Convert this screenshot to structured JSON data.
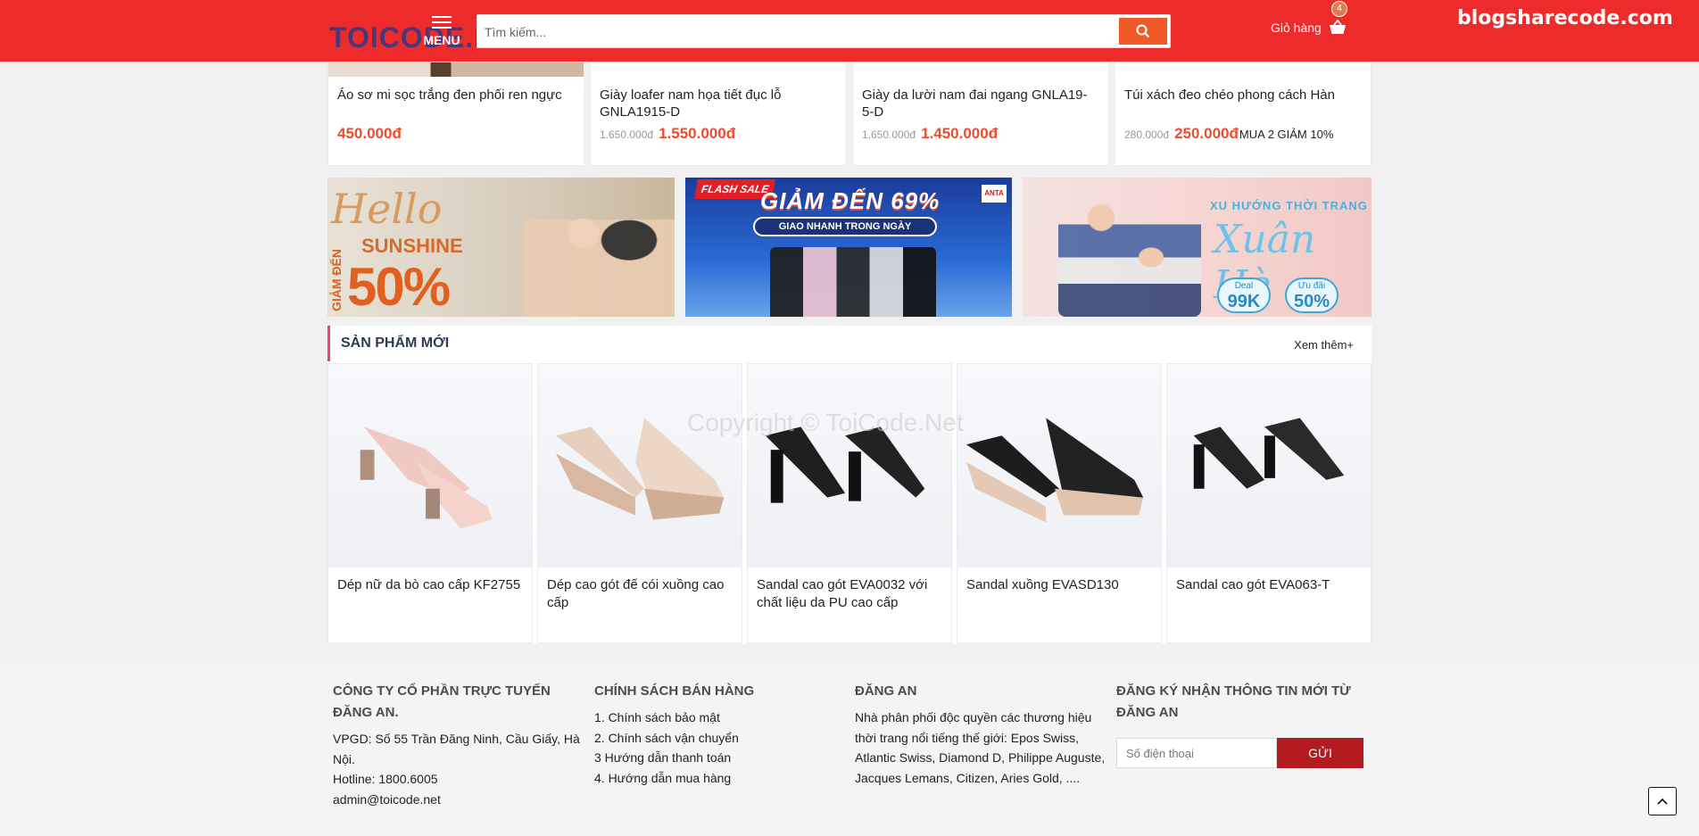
{
  "header": {
    "logo": "TOICODE.N",
    "menu_label": "MENU",
    "search_placeholder": "Tìm kiếm...",
    "cart_label": "Giỏ hàng",
    "cart_count": "4",
    "watermark": "blogsharecode.com"
  },
  "top_products": [
    {
      "name": "Áo sơ mi sọc trắng đen phối ren ngực",
      "old_price": "",
      "price": "450.000đ",
      "promo": ""
    },
    {
      "name": "Giày loafer nam họa tiết đục lỗ GNLA1915-D",
      "old_price": "1.650.000đ",
      "price": "1.550.000đ",
      "promo": ""
    },
    {
      "name": "Giày da lười nam đai ngang GNLA19-5-D",
      "old_price": "1.650.000đ",
      "price": "1.450.000đ",
      "promo": ""
    },
    {
      "name": "Túi xách đeo chéo phong cách Hàn",
      "old_price": "280.000đ",
      "price": "250.000đ",
      "promo": "MUA 2 GIẢM 10%"
    }
  ],
  "banners": {
    "b1": {
      "hello": "Hello",
      "sunshine": "SUNSHINE",
      "giam": "GIẢM ĐẾN",
      "percent": "50%"
    },
    "b2": {
      "flash": "FLASH SALE",
      "title": "GIẢM ĐẾN 69%",
      "ship": "GIAO NHANH TRONG NGÀY",
      "brand": "ANTA"
    },
    "b3": {
      "trend": "XU HƯỚNG THỜI TRANG",
      "title": "Xuân Hè",
      "deal_label": "Deal",
      "deal_value": "99K",
      "offer_label": "Ưu đãi",
      "offer_value": "50%"
    }
  },
  "new_products": {
    "title": "SẢN PHẨM MỚI",
    "more": "Xem thêm+",
    "items": [
      {
        "name": "Dép nữ da bò cao cấp KF2755"
      },
      {
        "name": "Dép cao gót đế cói xuồng cao cấp"
      },
      {
        "name": "Sandal cao gót EVA0032 với chất liệu da PU cao cấp"
      },
      {
        "name": "Sandal xuồng EVASD130"
      },
      {
        "name": "Sandal cao gót EVA063-T"
      }
    ]
  },
  "copyright": "Copyright © ToiCode.Net",
  "footer": {
    "col1": {
      "title": "CÔNG TY CỔ PHẦN TRỰC TUYẾN ĐĂNG AN.",
      "address": "VPGD: Số 55 Trần Đăng Ninh, Cầu Giấy, Hà Nội.",
      "hotline": "Hotline: 1800.6005",
      "email": "admin@toicode.net"
    },
    "col2": {
      "title": "CHÍNH SÁCH BÁN HÀNG",
      "links": [
        "1. Chính sách bảo mật",
        "2. Chính sách vận chuyển",
        "3 Hướng dẫn thanh toán",
        "4. Hướng dẫn mua hàng"
      ]
    },
    "col3": {
      "title": "ĐĂNG AN",
      "text": "Nhà phân phối độc quyền các thương hiệu thời trang nổi tiếng thế giới: Epos Swiss, Atlantic Swiss, Diamond D, Philippe Auguste, Jacques Lemans, Citizen, Aries Gold, ...."
    },
    "col4": {
      "title": "ĐĂNG KÝ NHẬN THÔNG TIN MỚI TỪ ĐĂNG AN",
      "placeholder": "Số điện thoại",
      "button": "GỬI"
    }
  },
  "colors": {
    "brand_red": "#ee2a2a",
    "price": "#ee4d2d",
    "accent_orange": "#f05a28",
    "submit": "#b31b20"
  }
}
